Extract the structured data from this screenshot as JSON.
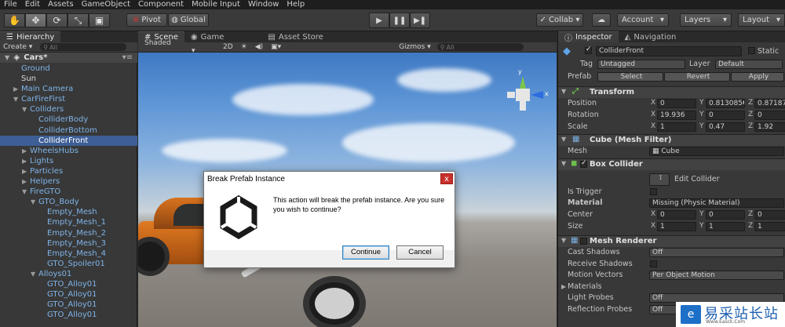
{
  "menu": [
    "File",
    "Edit",
    "Assets",
    "GameObject",
    "Component",
    "Mobile Input",
    "Window",
    "Help"
  ],
  "toolbar": {
    "pivot": "Pivot",
    "global": "Global",
    "collab": "Collab ▾",
    "account": "Account",
    "layers": "Layers",
    "layout": "Layout"
  },
  "hierarchy": {
    "tab": "Hierarchy",
    "create": "Create ▾",
    "search_placeholder": "All",
    "scene_name": "Cars*",
    "items": [
      {
        "label": "Ground",
        "indent": 1,
        "arrow": "",
        "selected": false
      },
      {
        "label": "Sun",
        "indent": 1,
        "arrow": "",
        "selected": false,
        "white": true
      },
      {
        "label": "Main Camera",
        "indent": 1,
        "arrow": "▶",
        "selected": false
      },
      {
        "label": "CarFireFirst",
        "indent": 1,
        "arrow": "▼",
        "selected": false
      },
      {
        "label": "Colliders",
        "indent": 2,
        "arrow": "▼",
        "selected": false
      },
      {
        "label": "ColliderBody",
        "indent": 3,
        "arrow": "",
        "selected": false
      },
      {
        "label": "ColliderBottom",
        "indent": 3,
        "arrow": "",
        "selected": false
      },
      {
        "label": "ColliderFront",
        "indent": 3,
        "arrow": "",
        "selected": true
      },
      {
        "label": "WheelsHubs",
        "indent": 2,
        "arrow": "▶",
        "selected": false
      },
      {
        "label": "Lights",
        "indent": 2,
        "arrow": "▶",
        "selected": false
      },
      {
        "label": "Particles",
        "indent": 2,
        "arrow": "▶",
        "selected": false
      },
      {
        "label": "Helpers",
        "indent": 2,
        "arrow": "▶",
        "selected": false
      },
      {
        "label": "FireGTO",
        "indent": 2,
        "arrow": "▼",
        "selected": false
      },
      {
        "label": "GTO_Body",
        "indent": 3,
        "arrow": "▼",
        "selected": false
      },
      {
        "label": "Empty_Mesh",
        "indent": 4,
        "arrow": "",
        "selected": false
      },
      {
        "label": "Empty_Mesh_1",
        "indent": 4,
        "arrow": "",
        "selected": false
      },
      {
        "label": "Empty_Mesh_2",
        "indent": 4,
        "arrow": "",
        "selected": false
      },
      {
        "label": "Empty_Mesh_3",
        "indent": 4,
        "arrow": "",
        "selected": false
      },
      {
        "label": "Empty_Mesh_4",
        "indent": 4,
        "arrow": "",
        "selected": false
      },
      {
        "label": "GTO_Spoiler01",
        "indent": 4,
        "arrow": "",
        "selected": false
      },
      {
        "label": "Alloys01",
        "indent": 3,
        "arrow": "▼",
        "selected": false
      },
      {
        "label": "GTO_Alloy01",
        "indent": 4,
        "arrow": "",
        "selected": false
      },
      {
        "label": "GTO_Alloy01",
        "indent": 4,
        "arrow": "",
        "selected": false
      },
      {
        "label": "GTO_Alloy01",
        "indent": 4,
        "arrow": "",
        "selected": false
      },
      {
        "label": "GTO_Alloy01",
        "indent": 4,
        "arrow": "",
        "selected": false
      }
    ]
  },
  "scene": {
    "tabs": [
      "Scene",
      "Game",
      "Asset Store"
    ],
    "shading": "Shaded",
    "mode_2d": "2D",
    "gizmos": "Gizmos ▾",
    "search_placeholder": "All",
    "gizmo_x": "x",
    "gizmo_y": "y"
  },
  "inspector": {
    "tabs": [
      "Inspector",
      "Navigation"
    ],
    "object_name": "ColliderFront",
    "static_label": "Static",
    "tag_label": "Tag",
    "tag_value": "Untagged",
    "layer_label": "Layer",
    "layer_value": "Default",
    "prefab_label": "Prefab",
    "prefab_select": "Select",
    "prefab_revert": "Revert",
    "prefab_apply": "Apply",
    "transform": {
      "title": "Transform",
      "position": {
        "label": "Position",
        "x": "0",
        "y": "0.813085€",
        "z": "0.87187"
      },
      "rotation": {
        "label": "Rotation",
        "x": "19.936",
        "y": "0",
        "z": "0"
      },
      "scale": {
        "label": "Scale",
        "x": "1",
        "y": "0.47",
        "z": "1.92"
      }
    },
    "mesh_filter": {
      "title": "Cube (Mesh Filter)",
      "mesh_label": "Mesh",
      "mesh_value": "Cube"
    },
    "box_collider": {
      "title": "Box Collider",
      "edit_label": "Edit Collider",
      "is_trigger": "Is Trigger",
      "material_label": "Material",
      "material_value": "Missing (Physic Material)",
      "center_label": "Center",
      "center": {
        "x": "0",
        "y": "0",
        "z": "0"
      },
      "size_label": "Size",
      "size": {
        "x": "1",
        "y": "1",
        "z": "1"
      }
    },
    "mesh_renderer": {
      "title": "Mesh Renderer",
      "cast_shadows": "Cast Shadows",
      "cast_value": "Off",
      "receive_shadows": "Receive Shadows",
      "motion_vectors": "Motion Vectors",
      "motion_value": "Per Object Motion",
      "materials": "Materials",
      "light_probes": "Light Probes",
      "light_value": "Off",
      "reflection_probes": "Reflection Probes",
      "reflection_value": "Off"
    },
    "axis_x": "X",
    "axis_y": "Y",
    "axis_z": "Z"
  },
  "dialog": {
    "title": "Break Prefab Instance",
    "message": "This action will break the prefab instance. Are you sure you wish to continue?",
    "continue_label": "Continue",
    "cancel_label": "Cancel",
    "close_glyph": "x"
  },
  "watermark": {
    "text": "易采站长站",
    "subtext": "Www.Easck.Com"
  }
}
